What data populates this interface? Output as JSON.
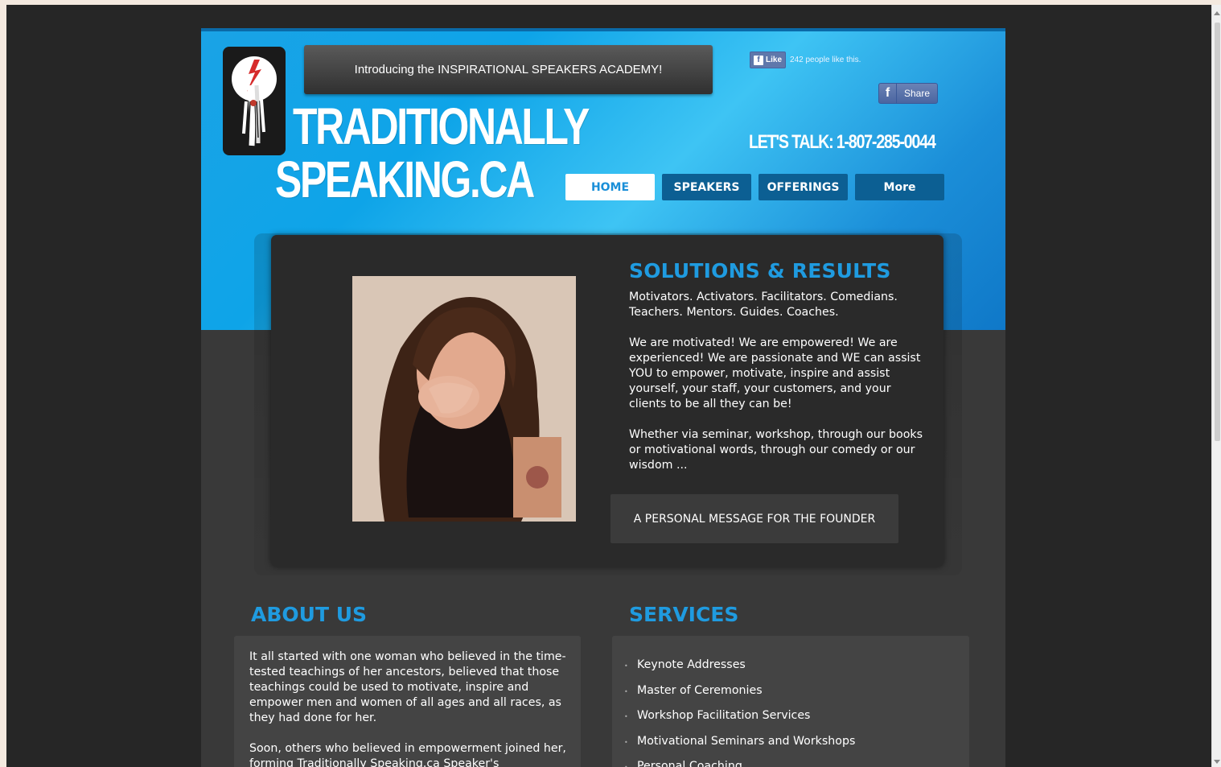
{
  "announcement": "Introducing the INSPIRATIONAL SPEAKERS ACADEMY!",
  "brand": {
    "line1": "TRADITIONALLY",
    "line2": "SPEAKING.CA"
  },
  "facebook": {
    "like_label": "Like",
    "like_count_text": "242 people like this.",
    "share_label": "Share"
  },
  "phone": "LET'S TALK: 1-807-285-0044",
  "nav": {
    "items": [
      "HOME",
      "SPEAKERS",
      "OFFERINGS",
      "More"
    ],
    "active": "HOME"
  },
  "feature": {
    "title": "SOLUTIONS & RESULTS",
    "p1": "Motivators.  Activators.  Facilitators.  Comedians. Teachers.  Mentors.  Guides.  Coaches.",
    "p2": "We are motivated!  We are empowered!  We are experienced!  We are passionate and WE can assist YOU to empower, motivate, inspire and assist yourself, your staff, your customers, and your clients to be all they can be!",
    "p3": "Whether via seminar, workshop, through our books or motivational words, through our comedy or our wisdom ...",
    "button": "A PERSONAL MESSAGE FOR THE FOUNDER"
  },
  "about": {
    "title": "ABOUT US",
    "p1": "It all started with one woman who believed in the time-tested teachings of her ancestors, believed that those teachings could be used to motivate, inspire and empower men and women of all ages and all races, as they had done for her.",
    "p2": "Soon, others who believed in empowerment joined her, forming Traditionally Speaking.ca Speaker's"
  },
  "services": {
    "title": "SERVICES",
    "items": [
      "Keynote Addresses",
      "Master of Ceremonies",
      "Workshop Facilitation Services",
      "Motivational Seminars and Workshops",
      "Personal Coaching"
    ]
  },
  "colors": {
    "accent": "#1f9be0",
    "nav": "#0c5f93",
    "header_blue": "#1aa3e6",
    "background": "#262626"
  }
}
